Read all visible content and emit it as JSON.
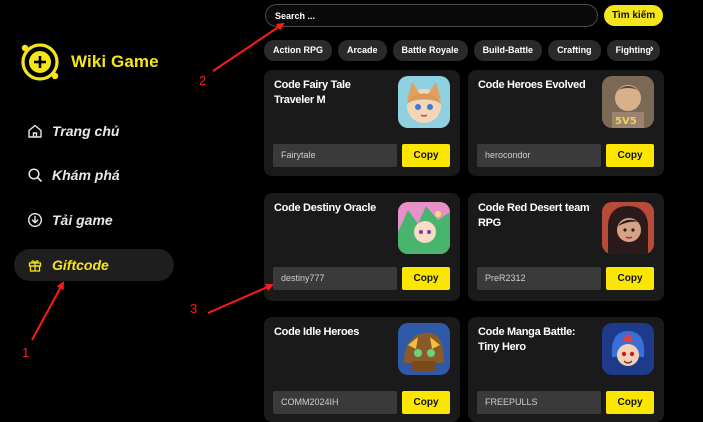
{
  "brand": {
    "name": "Wiki Game"
  },
  "sidebar": {
    "items": [
      {
        "label": "Trang chủ",
        "icon": "home-icon"
      },
      {
        "label": "Khám phá",
        "icon": "search-icon"
      },
      {
        "label": "Tải game",
        "icon": "download-icon"
      },
      {
        "label": "Giftcode",
        "icon": "gift-icon",
        "active": true
      }
    ]
  },
  "search": {
    "placeholder": "Search ...",
    "button_label": "Tìm kiếm"
  },
  "categories": [
    "Action RPG",
    "Arcade",
    "Battle Royale",
    "Build-Battle",
    "Crafting",
    "Fighting"
  ],
  "category_next": "›",
  "cards": [
    {
      "title": "Code Fairy Tale Traveler M",
      "code": "Fairytale",
      "copy_label": "Copy"
    },
    {
      "title": "Code Heroes Evolved",
      "code": "herocondor",
      "copy_label": "Copy"
    },
    {
      "title": "Code Destiny Oracle",
      "code": "destiny777",
      "copy_label": "Copy"
    },
    {
      "title": "Code Red Desert team RPG",
      "code": "PreR2312",
      "copy_label": "Copy"
    },
    {
      "title": "Code Idle Heroes",
      "code": "COMM2024IH",
      "copy_label": "Copy"
    },
    {
      "title": "Code Manga Battle: Tiny Hero",
      "code": "FREEPULLS",
      "copy_label": "Copy"
    }
  ],
  "annotations": {
    "one": "1",
    "two": "2",
    "three": "3"
  },
  "colors": {
    "accent": "#f5e51b",
    "annotation": "#ff1a1a",
    "card": "#1a1a1a"
  }
}
